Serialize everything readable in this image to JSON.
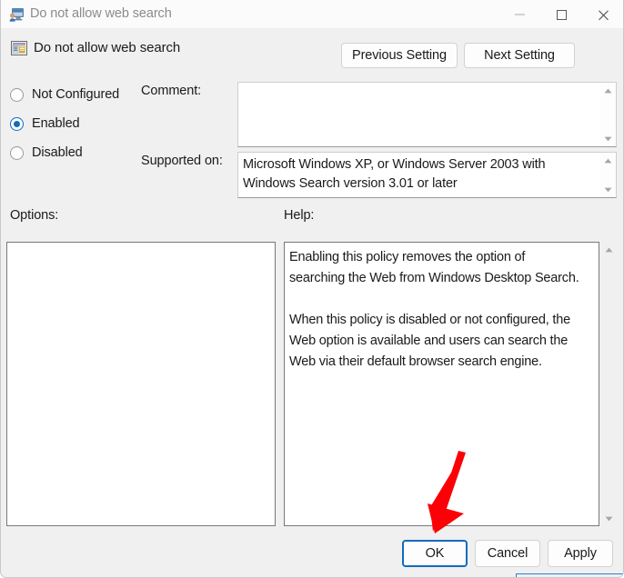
{
  "window": {
    "title": "Do not allow web search",
    "icon": "policy-computer-icon",
    "controls": {
      "minimize": "minimize-icon",
      "maximize": "maximize-icon",
      "close": "close-icon"
    }
  },
  "header": {
    "icon": "policy-setting-icon",
    "caption": "Do not allow web search",
    "previous_setting_label": "Previous Setting",
    "next_setting_label": "Next Setting"
  },
  "state_options": {
    "selected": "Enabled",
    "items": [
      {
        "label": "Not Configured",
        "checked": false
      },
      {
        "label": "Enabled",
        "checked": true
      },
      {
        "label": "Disabled",
        "checked": false
      }
    ]
  },
  "comment": {
    "label": "Comment:",
    "value": "",
    "scrollbar": {
      "up": "scroll-up-arrow",
      "down": "scroll-down-arrow"
    }
  },
  "supported_on": {
    "label": "Supported on:",
    "value": "Microsoft Windows XP, or Windows Server 2003 with Windows Search version 3.01 or later",
    "scrollbar": {
      "up": "scroll-up-arrow",
      "down": "scroll-down-arrow"
    }
  },
  "options": {
    "label": "Options:",
    "value": ""
  },
  "help": {
    "label": "Help:",
    "text": "Enabling this policy removes the option of searching the Web from Windows Desktop Search.\n\nWhen this policy is disabled or not configured, the Web option is available and users can search the Web via their default browser search engine.",
    "scrollbar": {
      "up": "scroll-up-arrow",
      "down": "scroll-down-arrow"
    }
  },
  "footer": {
    "ok_label": "OK",
    "cancel_label": "Cancel",
    "apply_label": "Apply"
  },
  "annotation": {
    "arrow": "red-pointer-arrow",
    "color": "#fb0007",
    "points_at": "OK"
  },
  "colors": {
    "accent": "#0f6cbd",
    "dialog_bg": "#f0f0f0",
    "field_bg": "#ffffff",
    "text": "#1a1a1a",
    "title_text": "#8b8b8b"
  }
}
